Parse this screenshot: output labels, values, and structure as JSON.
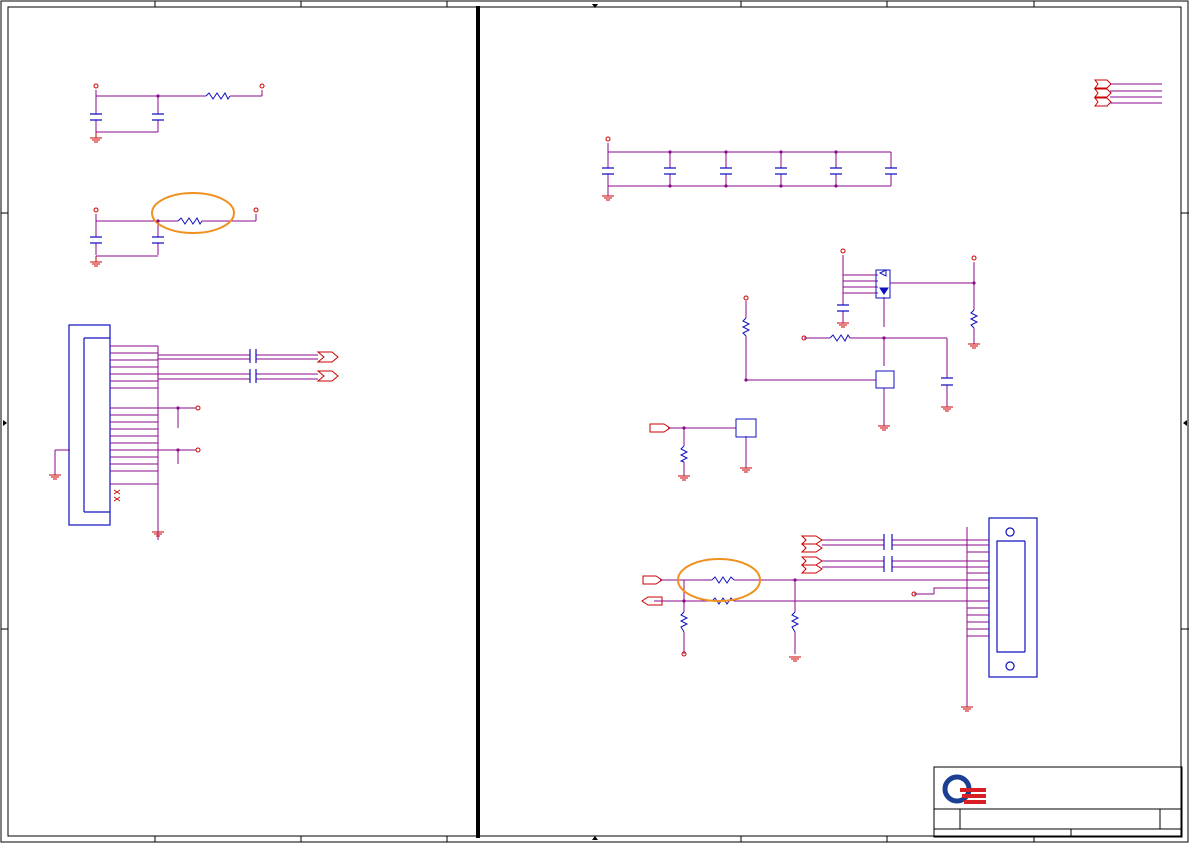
{
  "sheet": {
    "background": "#ffffff",
    "border_color": "#000000",
    "wire_color": "#8b0a8b",
    "net_color": "#cc0000",
    "component_color": "#1010c0",
    "highlight_color": "#f0901e",
    "title_block": {
      "title": "",
      "sheet": ""
    },
    "logo": {
      "name": "company-logo-icon",
      "colors": [
        "#1c3f94",
        "#d71f26"
      ]
    }
  }
}
